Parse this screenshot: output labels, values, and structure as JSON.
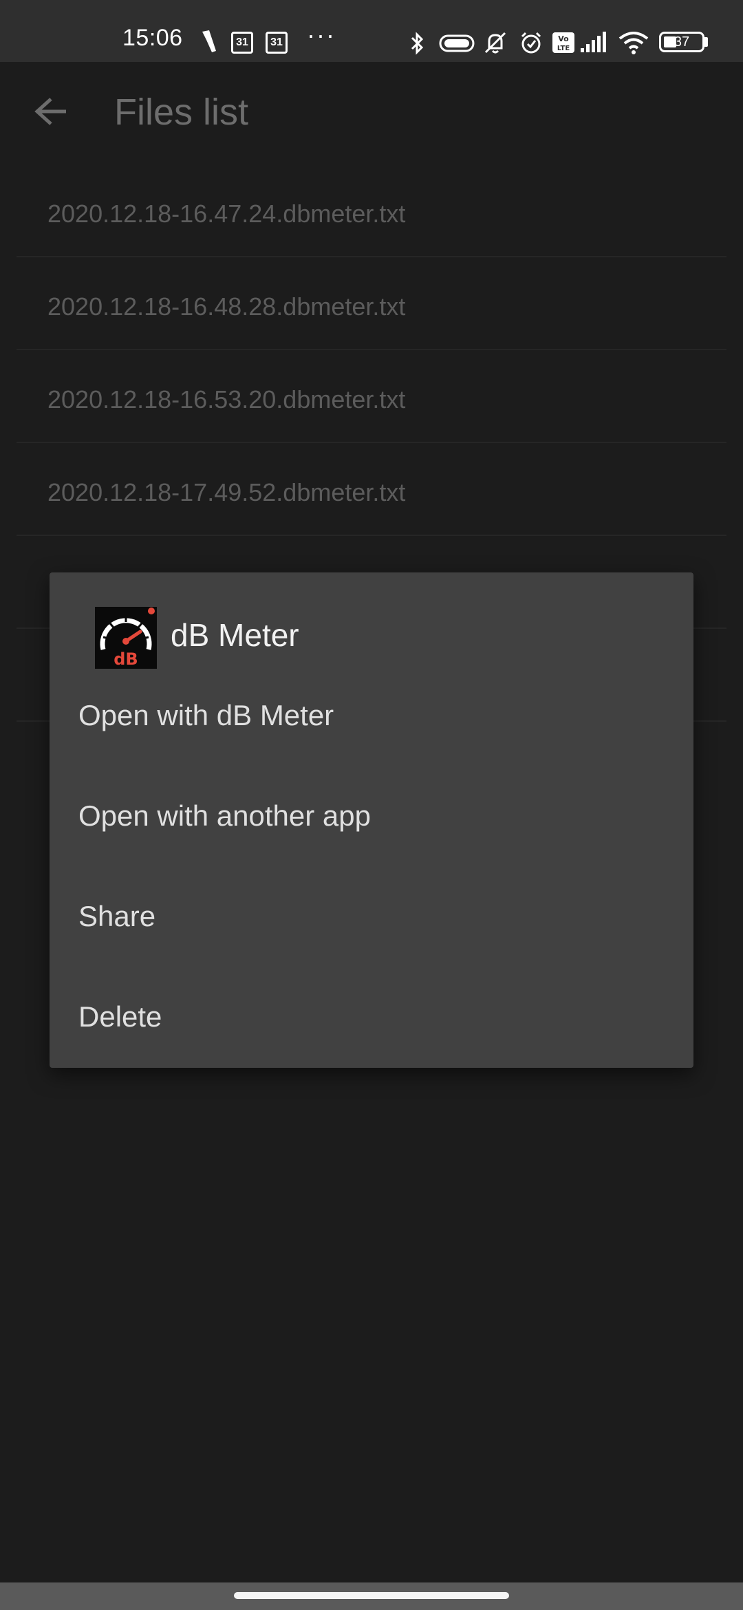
{
  "status_bar": {
    "time": "15:06",
    "calendar_day_1": "31",
    "calendar_day_2": "31",
    "more": "···",
    "battery_level": "37",
    "battery_fraction": 0.37,
    "icons": [
      "flashlight-icon",
      "calendar-icon",
      "calendar-icon",
      "more-icon",
      "bluetooth-icon",
      "toggle-icon",
      "bell-off-icon",
      "alarm-icon",
      "volte-icon",
      "signal-icon",
      "wifi-icon",
      "battery-icon"
    ]
  },
  "app_bar": {
    "title": "Files list",
    "back_icon": "arrow-left-icon"
  },
  "files": [
    "2020.12.18-16.47.24.dbmeter.txt",
    "2020.12.18-16.48.28.dbmeter.txt",
    "2020.12.18-16.53.20.dbmeter.txt",
    "2020.12.18-17.49.52.dbmeter.txt",
    "",
    ""
  ],
  "dialog": {
    "app_name": "dB Meter",
    "app_icon": "speedometer-icon",
    "icon_badge": "dB",
    "actions": [
      "Open with dB Meter",
      "Open with another app",
      "Share",
      "Delete"
    ]
  },
  "colors": {
    "background": "#1c1c1c",
    "dialog": "#414141",
    "accent_red": "#e4483a"
  }
}
